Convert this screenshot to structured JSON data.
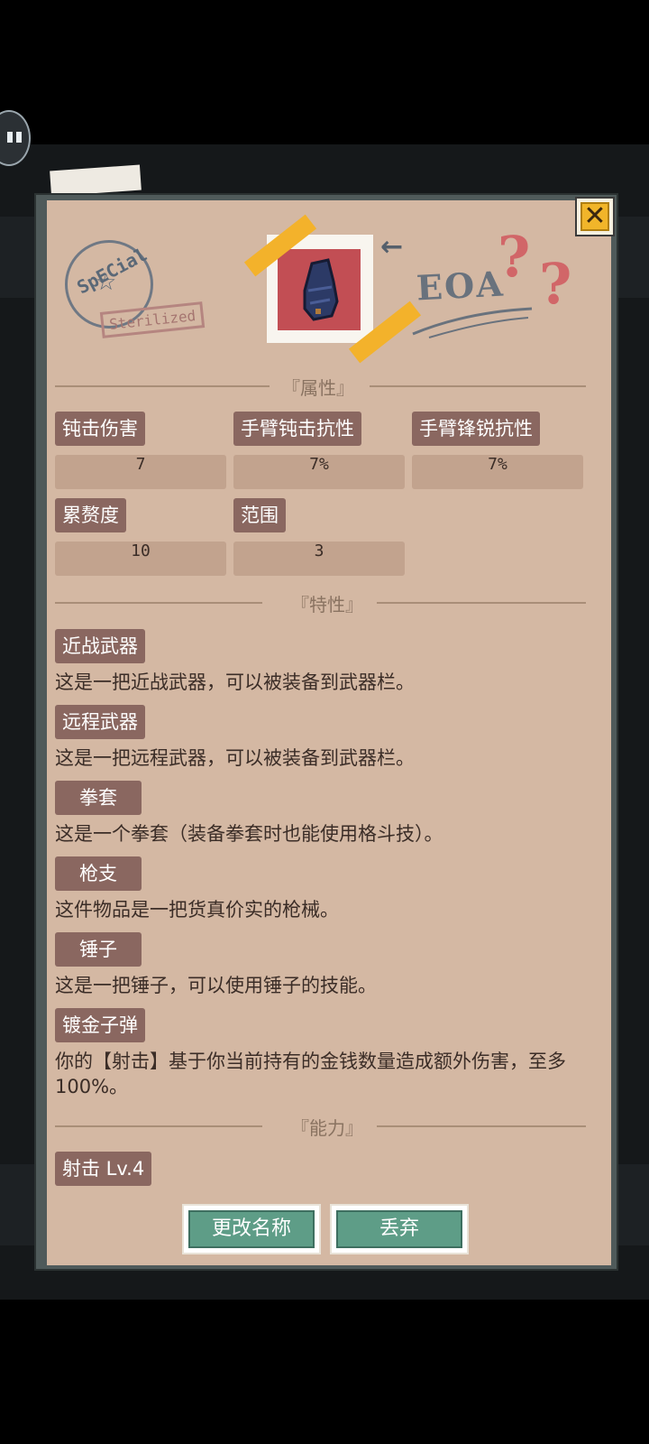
{
  "stamp": {
    "text": "SpECial",
    "star": "☆",
    "label": "Sterilized"
  },
  "header": {
    "close_label": "✕",
    "scribble": "EOA",
    "arrow": "←",
    "qmarks": [
      "?",
      "?"
    ]
  },
  "item": {
    "icon": "gauntlet-icon"
  },
  "sections": {
    "attributes": "『属性』",
    "traits": "『特性』",
    "abilities": "『能力』"
  },
  "stats": [
    {
      "label": "钝击伤害",
      "value": "7"
    },
    {
      "label": "手臂钝击抗性",
      "value": "7%"
    },
    {
      "label": "手臂锋锐抗性",
      "value": "7%"
    },
    {
      "label": "累赘度",
      "value": "10"
    },
    {
      "label": "范围",
      "value": "3"
    }
  ],
  "traits": [
    {
      "name": "近战武器",
      "desc": "这是一把近战武器，可以被装备到武器栏。"
    },
    {
      "name": "远程武器",
      "desc": "这是一把远程武器，可以被装备到武器栏。"
    },
    {
      "name": "拳套",
      "desc": "这是一个拳套（装备拳套时也能使用格斗技）。"
    },
    {
      "name": "枪支",
      "desc": "这件物品是一把货真价实的枪械。"
    },
    {
      "name": "锤子",
      "desc": "这是一把锤子，可以使用锤子的技能。"
    },
    {
      "name": "镀金子弹",
      "desc": "你的【射击】基于你当前持有的金钱数量造成额外伤害，至多100%。"
    }
  ],
  "abilities": [
    {
      "label": "射击 Lv.4"
    }
  ],
  "buttons": {
    "rename": "更改名称",
    "discard": "丢弃"
  }
}
